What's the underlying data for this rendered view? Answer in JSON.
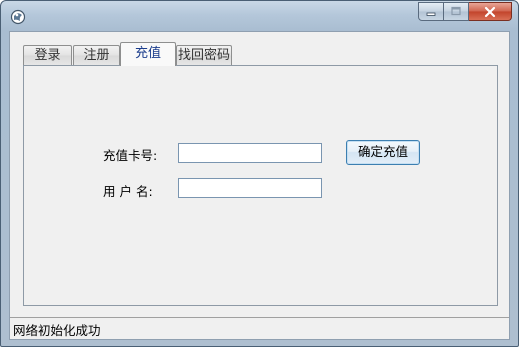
{
  "window": {
    "title": "",
    "controls": {
      "minimize_icon": "minimize-icon",
      "maximize_icon": "maximize-icon",
      "close_icon": "close-icon"
    }
  },
  "tabs": [
    {
      "label": "登录",
      "active": false
    },
    {
      "label": "注册",
      "active": false
    },
    {
      "label": "充值",
      "active": true
    },
    {
      "label": "找回密码",
      "active": false
    }
  ],
  "recharge": {
    "card_label": "充值卡号:",
    "card_value": "",
    "user_label": "用 户 名:",
    "user_value": "",
    "confirm_label": "确定充值"
  },
  "status": {
    "text": "网络初始化成功"
  },
  "colors": {
    "active_tab_text": "#1a3c8c",
    "button_border": "#3c7fb1",
    "close_button": "#c2432b"
  }
}
